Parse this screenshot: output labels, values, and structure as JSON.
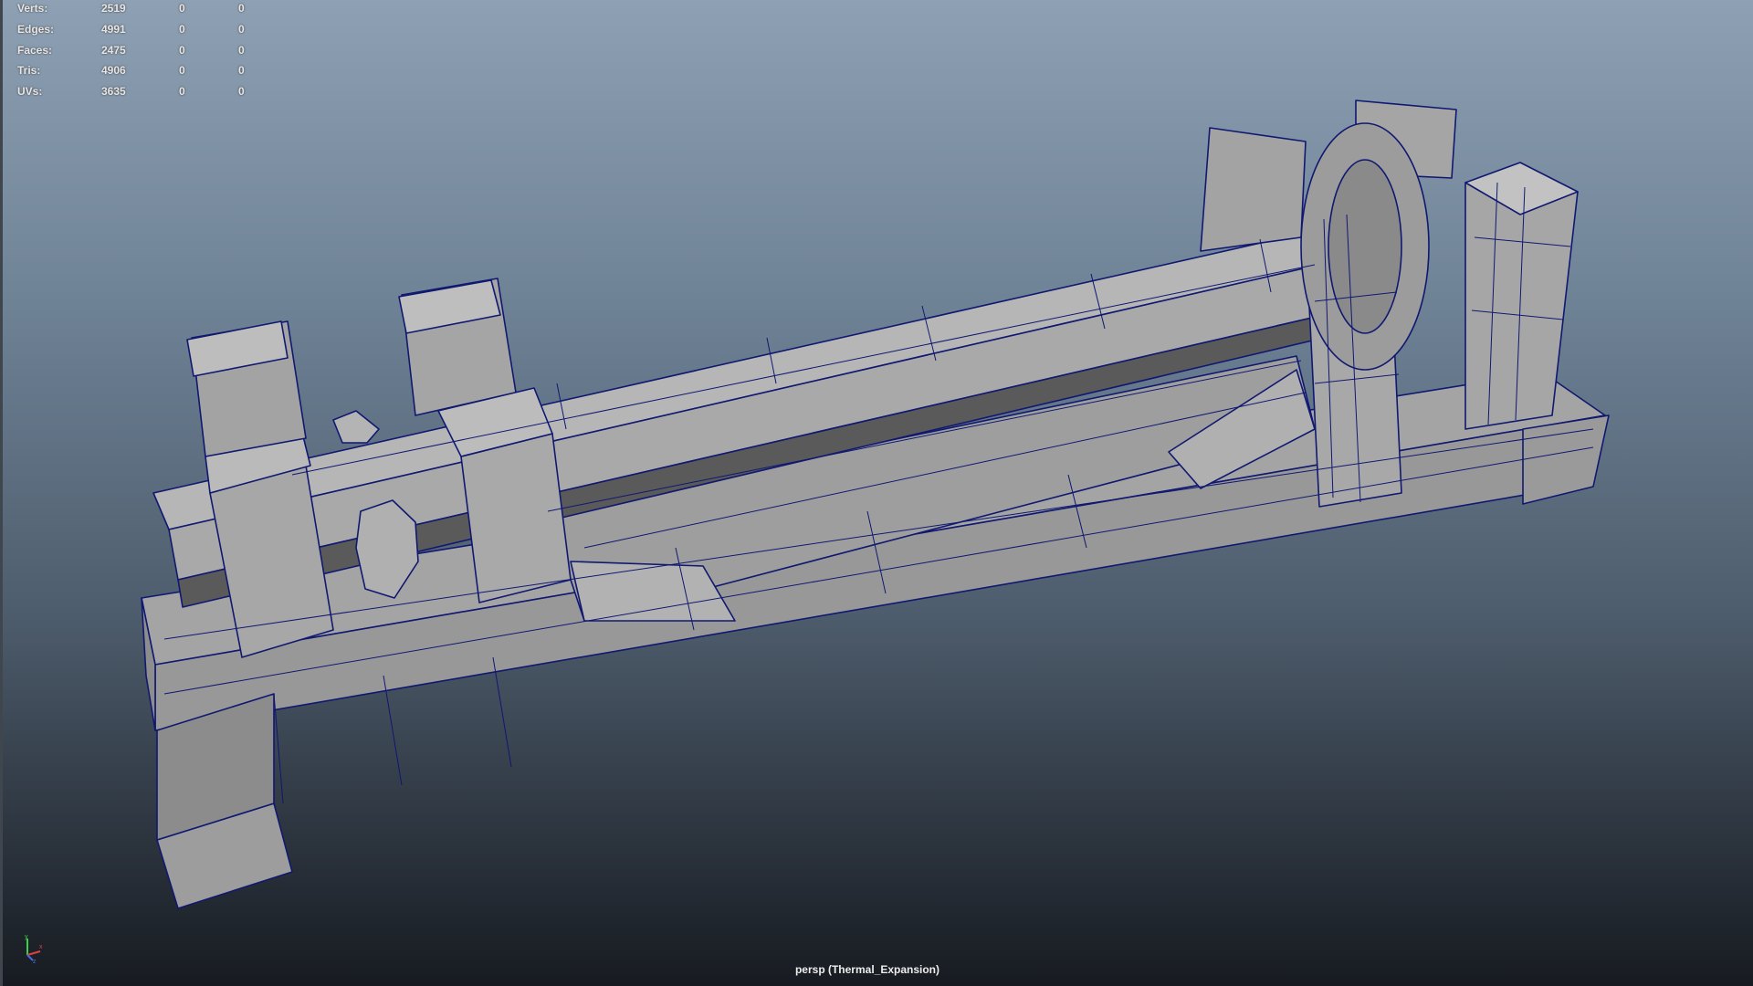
{
  "viewport": {
    "camera_label": "persp (Thermal_Expansion)",
    "background_top": "#8ea0b3",
    "background_bottom": "#171b21",
    "wire_color": "#101870",
    "face_color": "#a8a8a8"
  },
  "stats": [
    {
      "label": "Verts:",
      "v1": "2519",
      "v2": "0",
      "v3": "0"
    },
    {
      "label": "Edges:",
      "v1": "4991",
      "v2": "0",
      "v3": "0"
    },
    {
      "label": "Faces:",
      "v1": "2475",
      "v2": "0",
      "v3": "0"
    },
    {
      "label": "Tris:",
      "v1": "4906",
      "v2": "0",
      "v3": "0"
    },
    {
      "label": "UVs:",
      "v1": "3635",
      "v2": "0",
      "v3": "0"
    }
  ],
  "axis_gizmo": {
    "x": "x",
    "y": "y",
    "z": "z"
  }
}
